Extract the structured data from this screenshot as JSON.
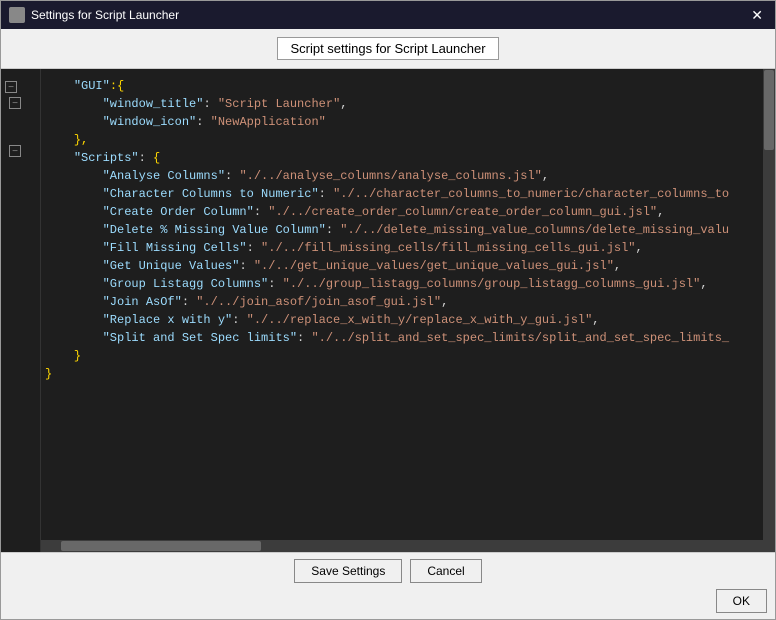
{
  "window": {
    "title": "Settings for Script Launcher",
    "close_label": "✕"
  },
  "dialog": {
    "header": "Script settings for Script Launcher"
  },
  "code": {
    "lines": [
      {
        "indent": "    ",
        "key": "\"GUI\"",
        "value": ":{"
      },
      {
        "indent": "        ",
        "key": "\"window_title\"",
        "value": ": \"Script Launcher\","
      },
      {
        "indent": "        ",
        "key": "\"window_icon\"",
        "value": ": \"NewApplication\""
      },
      {
        "indent": "    ",
        "key": "}",
        "value": ""
      },
      {
        "indent": "    ",
        "key": "\"Scripts\"",
        "value": ": {"
      },
      {
        "indent": "        ",
        "key": "\"Analyse Columns\"",
        "value": ": \"./../analyse_columns/analyse_columns.jsl\","
      },
      {
        "indent": "        ",
        "key": "\"Character Columns to Numeric\"",
        "value": ": \"./../character_columns_to_numeric/character_columns_to"
      },
      {
        "indent": "        ",
        "key": "\"Create Order Column\"",
        "value": ": \"./../create_order_column/create_order_column_gui.jsl\","
      },
      {
        "indent": "        ",
        "key": "\"Delete % Missing Value Column\"",
        "value": ": \"./../delete_missing_value_columns/delete_missing_valu"
      },
      {
        "indent": "        ",
        "key": "\"Fill Missing Cells\"",
        "value": ": \"./../fill_missing_cells/fill_missing_cells_gui.jsl\","
      },
      {
        "indent": "        ",
        "key": "\"Get Unique Values\"",
        "value": ": \"./../get_unique_values/get_unique_values_gui.jsl\","
      },
      {
        "indent": "        ",
        "key": "\"Group Listagg Columns\"",
        "value": ": \"./../group_listagg_columns/group_listagg_columns_gui.jsl\","
      },
      {
        "indent": "        ",
        "key": "\"Join AsOf\"",
        "value": ": \"./../join_asof/join_asof_gui.jsl\","
      },
      {
        "indent": "        ",
        "key": "\"Replace x with y\"",
        "value": ": \"./../replace_x_with_y/replace_x_with_y_gui.jsl\","
      },
      {
        "indent": "        ",
        "key": "\"Split and Set Spec limits\"",
        "value": ": \"./../split_and_set_spec_limits/split_and_set_spec_limits_"
      },
      {
        "indent": "    ",
        "key": "}",
        "value": ""
      },
      {
        "indent": "}",
        "key": "",
        "value": ""
      }
    ]
  },
  "buttons": {
    "save_settings": "Save Settings",
    "cancel": "Cancel",
    "ok": "OK"
  }
}
